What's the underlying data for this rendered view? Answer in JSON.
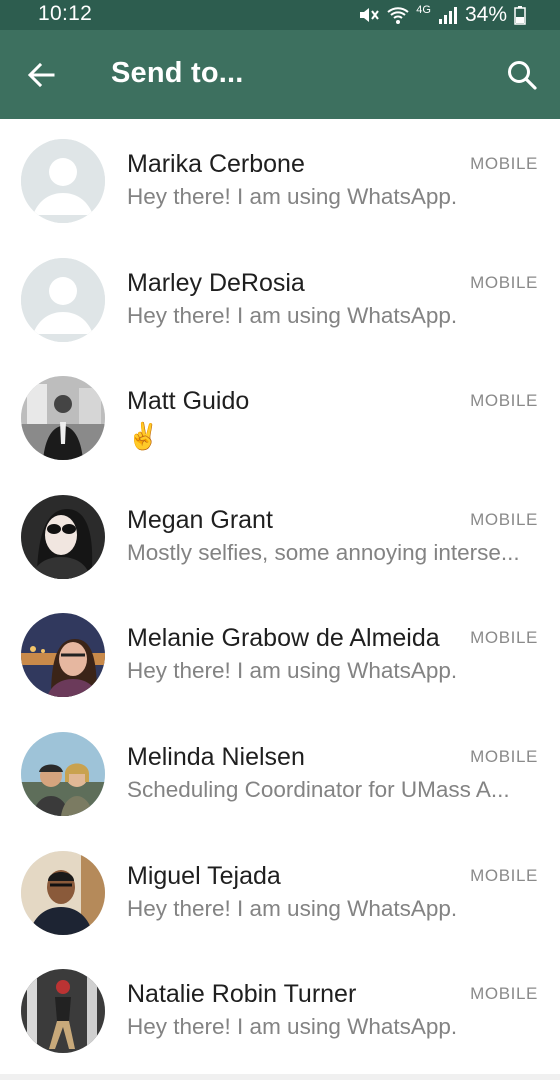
{
  "status_bar": {
    "time": "10:12",
    "network": "4G",
    "battery": "34%",
    "icons": [
      "mute-icon",
      "wifi-icon",
      "network-4g-icon",
      "signal-icon",
      "battery-icon"
    ]
  },
  "header": {
    "back_icon": "arrow-left-icon",
    "title": "Send to...",
    "search_icon": "search-icon",
    "background": "#3d705f",
    "status_bar_background": "#2d5d4f"
  },
  "contacts": [
    {
      "name": "Marika Cerbone",
      "status": "Hey there! I am using WhatsApp.",
      "type": "MOBILE",
      "avatar": "default"
    },
    {
      "name": "Marley DeRosia",
      "status": "Hey there! I am using WhatsApp.",
      "type": "MOBILE",
      "avatar": "default"
    },
    {
      "name": "Matt Guido",
      "status": "✌",
      "type": "MOBILE",
      "avatar": "photo"
    },
    {
      "name": "Megan Grant",
      "status": "Mostly selfies, some annoying interse...",
      "type": "MOBILE",
      "avatar": "photo"
    },
    {
      "name": "Melanie Grabow de Almeida",
      "status": "Hey there! I am using WhatsApp.",
      "type": "MOBILE",
      "avatar": "photo"
    },
    {
      "name": "Melinda Nielsen",
      "status": "Scheduling Coordinator for UMass A...",
      "type": "MOBILE",
      "avatar": "photo"
    },
    {
      "name": "Miguel Tejada",
      "status": "Hey there! I am using WhatsApp.",
      "type": "MOBILE",
      "avatar": "photo"
    },
    {
      "name": "Natalie Robin Turner",
      "status": "Hey there! I am using WhatsApp.",
      "type": "MOBILE",
      "avatar": "photo"
    }
  ]
}
